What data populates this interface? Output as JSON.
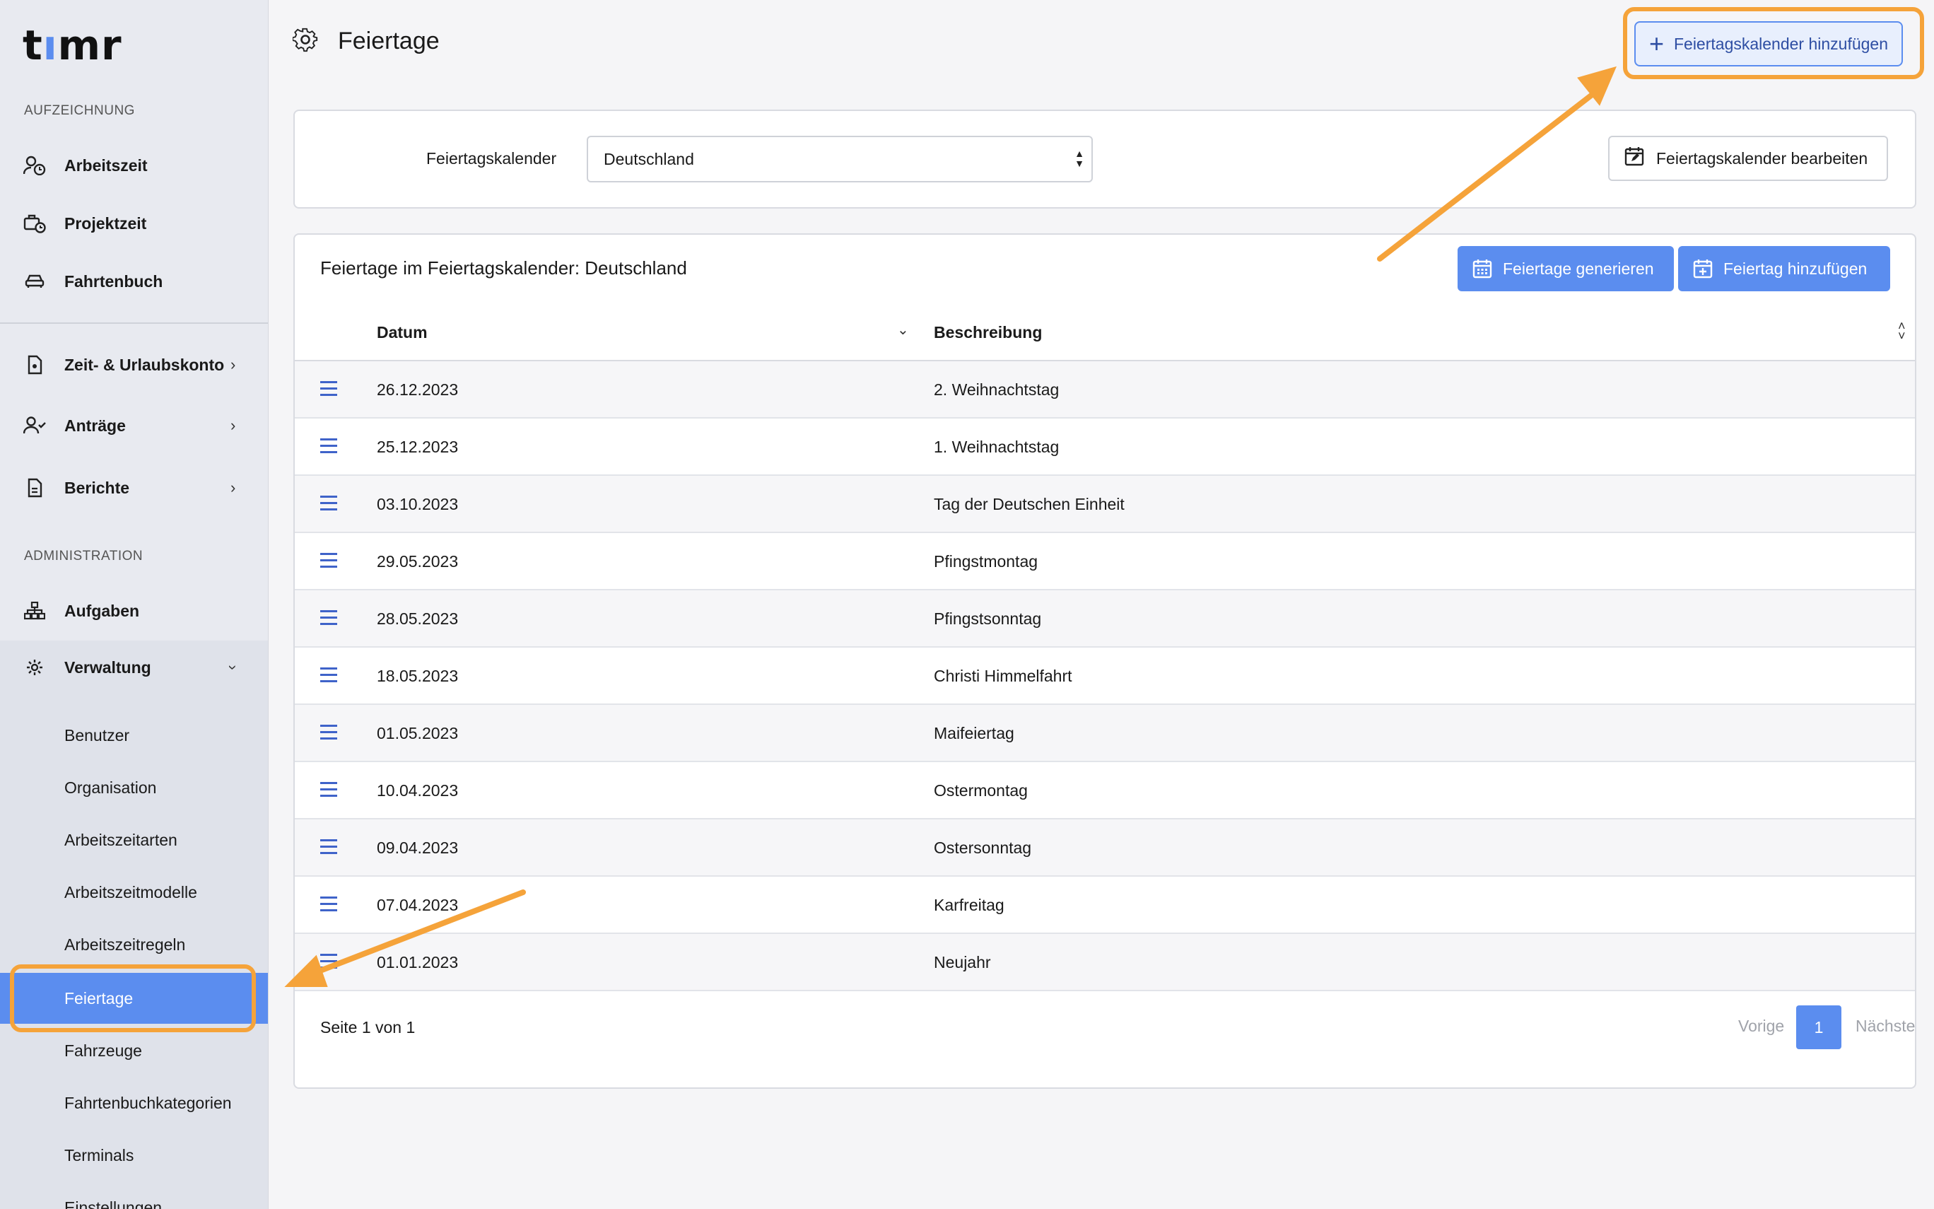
{
  "app": {
    "logo_text_a": "t",
    "logo_text_b": "ı",
    "logo_text_c": "mr"
  },
  "sidebar": {
    "section_recording": "AUFZEICHNUNG",
    "section_admin": "ADMINISTRATION",
    "items": [
      {
        "label": "Arbeitszeit",
        "icon": "user-clock-icon"
      },
      {
        "label": "Projektzeit",
        "icon": "briefcase-clock-icon"
      },
      {
        "label": "Fahrtenbuch",
        "icon": "car-icon"
      },
      {
        "label": "Zeit- & Urlaubskonto",
        "icon": "document-icon"
      },
      {
        "label": "Anträge",
        "icon": "user-check-icon"
      },
      {
        "label": "Berichte",
        "icon": "report-icon"
      },
      {
        "label": "Aufgaben",
        "icon": "hierarchy-icon"
      },
      {
        "label": "Verwaltung",
        "icon": "gear-icon"
      }
    ],
    "sub_items": [
      {
        "label": "Benutzer"
      },
      {
        "label": "Organisation"
      },
      {
        "label": "Arbeitszeitarten"
      },
      {
        "label": "Arbeitszeitmodelle"
      },
      {
        "label": "Arbeitszeitregeln"
      },
      {
        "label": "Feiertage",
        "active": true
      },
      {
        "label": "Fahrzeuge"
      },
      {
        "label": "Fahrtenbuchkategorien"
      },
      {
        "label": "Terminals"
      },
      {
        "label": "Einstellungen"
      }
    ]
  },
  "header": {
    "title": "Feiertage",
    "add_calendar_label": "Feiertagskalender hinzufügen"
  },
  "calendar_select": {
    "label": "Feiertagskalender",
    "value": "Deutschland",
    "edit_label": "Feiertagskalender bearbeiten"
  },
  "holidays": {
    "title": "Feiertage im Feiertagskalender: Deutschland",
    "generate_label": "Feiertage generieren",
    "add_label": "Feiertag hinzufügen",
    "columns": {
      "date": "Datum",
      "description": "Beschreibung"
    },
    "rows": [
      {
        "date": "26.12.2023",
        "description": "2. Weihnachtstag"
      },
      {
        "date": "25.12.2023",
        "description": "1. Weihnachtstag"
      },
      {
        "date": "03.10.2023",
        "description": "Tag der Deutschen Einheit"
      },
      {
        "date": "29.05.2023",
        "description": "Pfingstmontag"
      },
      {
        "date": "28.05.2023",
        "description": "Pfingstsonntag"
      },
      {
        "date": "18.05.2023",
        "description": "Christi Himmelfahrt"
      },
      {
        "date": "01.05.2023",
        "description": "Maifeiertag"
      },
      {
        "date": "10.04.2023",
        "description": "Ostermontag"
      },
      {
        "date": "09.04.2023",
        "description": "Ostersonntag"
      },
      {
        "date": "07.04.2023",
        "description": "Karfreitag"
      },
      {
        "date": "01.01.2023",
        "description": "Neujahr"
      }
    ],
    "pagination": {
      "status": "Seite 1 von 1",
      "prev": "Vorige",
      "current": "1",
      "next": "Nächste"
    }
  },
  "colors": {
    "accent": "#5b8def",
    "annotation": "#f5a33a"
  }
}
